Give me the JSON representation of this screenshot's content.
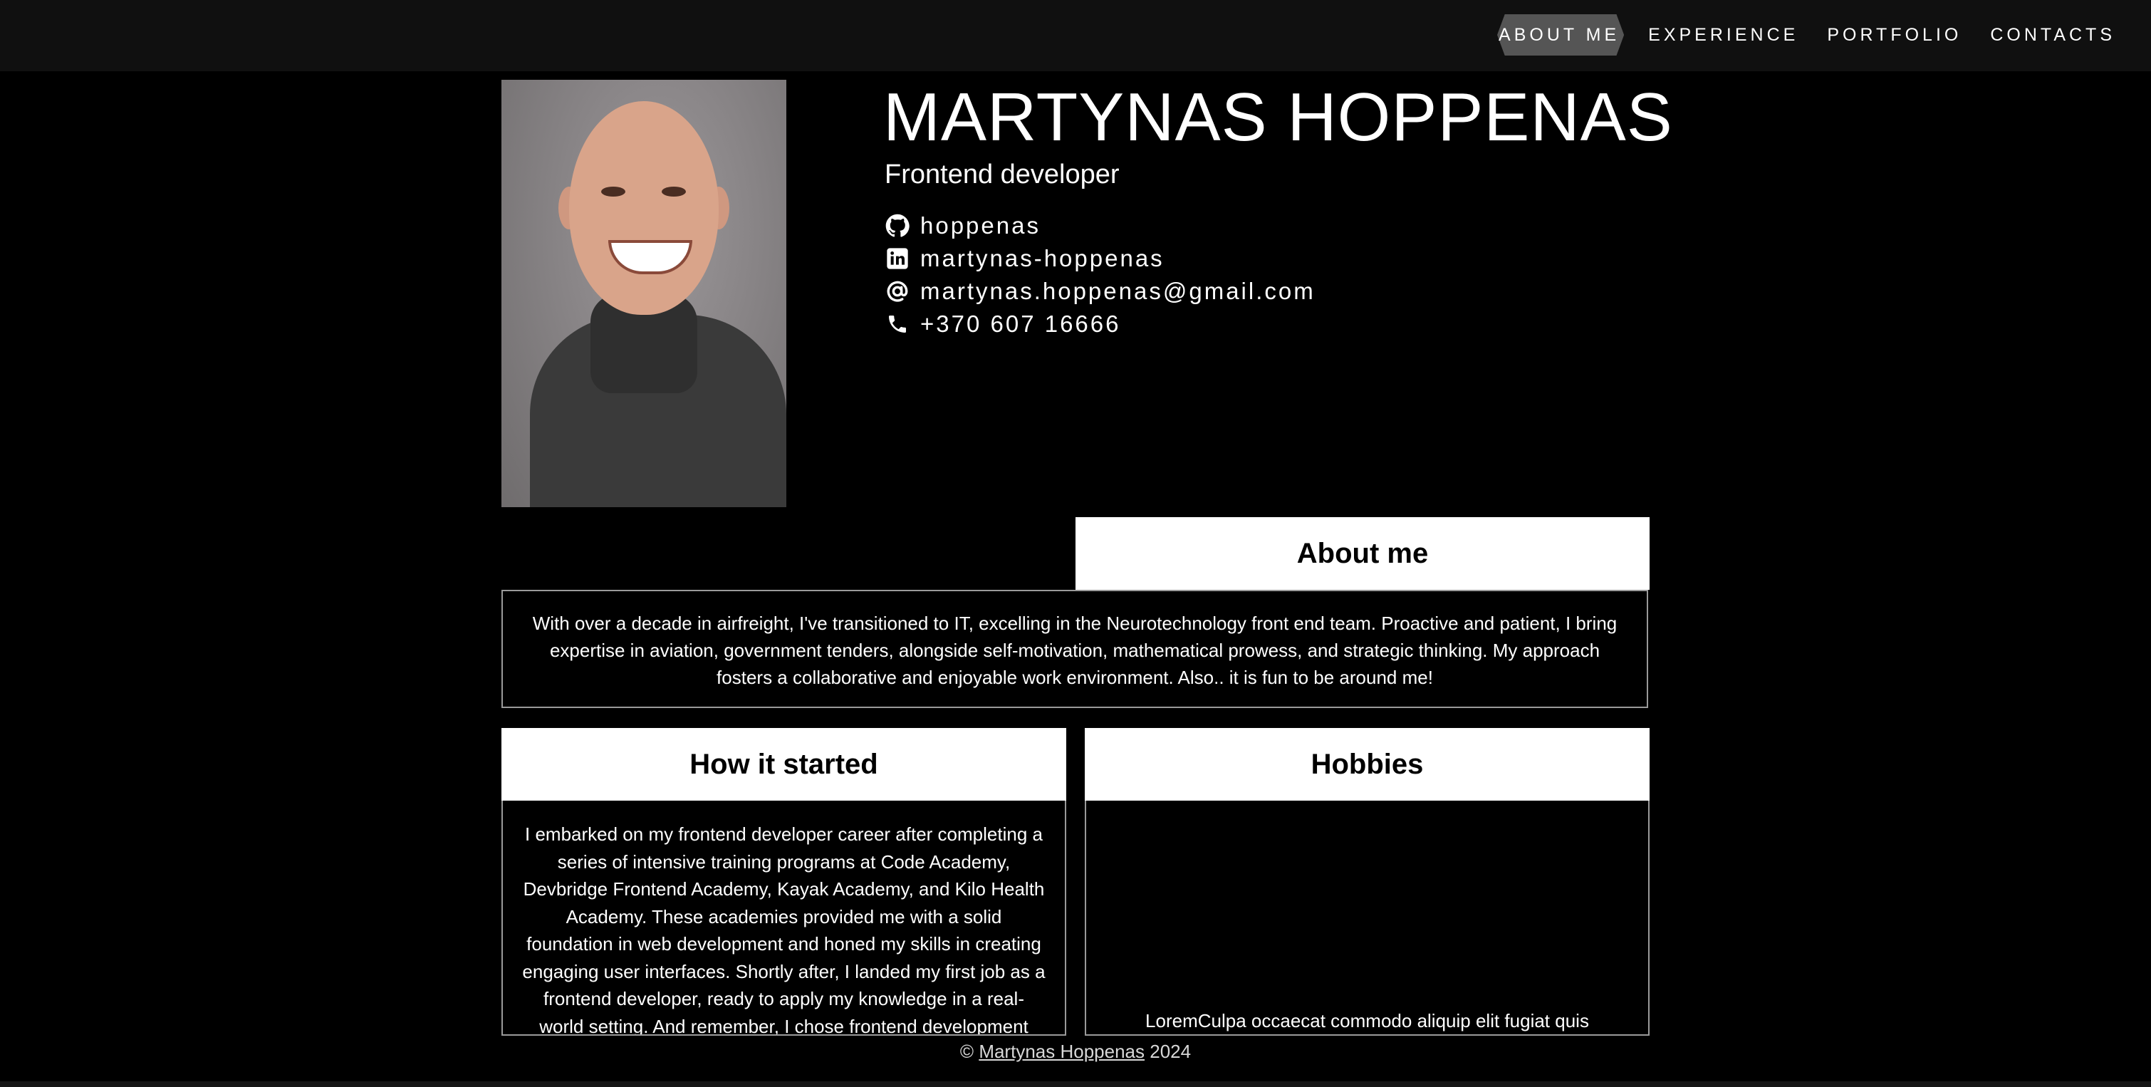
{
  "nav": {
    "items": [
      {
        "label": "ABOUT ME"
      },
      {
        "label": "EXPERIENCE"
      },
      {
        "label": "PORTFOLIO"
      },
      {
        "label": "CONTACTS"
      }
    ]
  },
  "profile": {
    "name": "MARTYNAS HOPPENAS",
    "role": "Frontend developer",
    "contacts": [
      {
        "icon": "github-icon",
        "text": "hoppenas"
      },
      {
        "icon": "linkedin-icon",
        "text": "martynas-hoppenas"
      },
      {
        "icon": "at-sign-icon",
        "text": "martynas.hoppenas@gmail.com"
      },
      {
        "icon": "phone-icon",
        "text": "+370 607 16666"
      }
    ]
  },
  "about": {
    "title": "About me",
    "text": "With over a decade in airfreight, I've transitioned to IT, excelling in the Neurotechnology front end team. Proactive and patient, I bring expertise in aviation, government tenders, alongside self-motivation, mathematical prowess, and strategic thinking. My approach fosters a collaborative and enjoyable work environment. Also.. it is fun to be around me!"
  },
  "how_it_started": {
    "title": "How it started",
    "text": "I embarked on my frontend developer career after completing a series of intensive training programs at Code Academy, Devbridge Frontend Academy, Kayak Academy, and Kilo Health Academy. These academies provided me with a solid foundation in web development and honed my skills in creating engaging user interfaces. Shortly after, I landed my first job as a frontend developer, ready to apply my knowledge in a real-world setting. And remember, I chose frontend development"
  },
  "hobbies": {
    "title": "Hobbies",
    "text": "LoremCulpa occaecat commodo aliquip elit fugiat quis"
  },
  "footer": {
    "copyright": "©",
    "author": "Martynas Hoppenas",
    "year": "2024"
  },
  "colors": {
    "background": "#000000",
    "topbar": "#101010",
    "active_nav": "#555555",
    "card_header": "#ffffff",
    "border": "#9a9a9a"
  }
}
